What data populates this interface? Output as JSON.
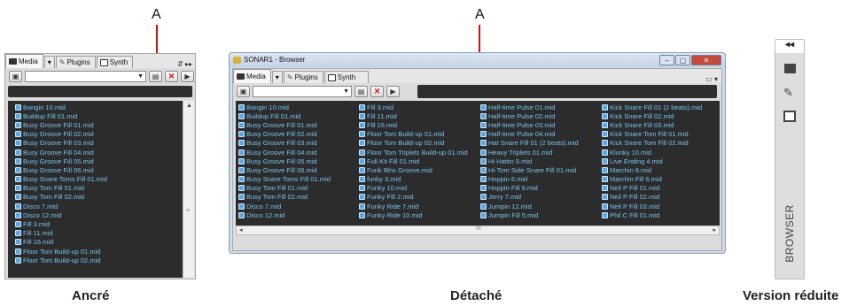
{
  "callouts": {
    "left": "A",
    "center": "A"
  },
  "captions": {
    "docked": "Ancré",
    "floating": "Détaché",
    "collapsed": "Version réduite"
  },
  "tabs": {
    "media": "Media",
    "plugins": "Plugins",
    "synth": "Synth"
  },
  "window_title": "SONAR1 - Browser",
  "collapsed_label": "BROWSER",
  "docked_files": [
    "Bangin 10.mid",
    "Buildup Fill 01.mid",
    "Busy Groove Fill 01.mid",
    "Busy Groove Fill 02.mid",
    "Busy Groove Fill 03.mid",
    "Busy Groove Fill 04.mid",
    "Busy Groove Fill 05.mid",
    "Busy Groove Fill 06.mid",
    "Busy Snare Toms Fill 01.mid",
    "Busy Tom Fill 01.mid",
    "Busy Tom Fill 02.mid",
    "Disco 7.mid",
    "Disco 12.mid",
    "Fill 3.mid",
    "Fill 11.mid",
    "Fill 16.mid",
    "Floor Tom Build-up 01.mid",
    "Floor Tom Build-up 02.mid"
  ],
  "floating_columns": [
    [
      "Bangin 10.mid",
      "Buildup Fill 01.mid",
      "Busy Groove Fill 01.mid",
      "Busy Groove Fill 02.mid",
      "Busy Groove Fill 03.mid",
      "Busy Groove Fill 04.mid",
      "Busy Groove Fill 05.mid",
      "Busy Groove Fill 06.mid",
      "Busy Snare Toms Fill 01.mid",
      "Busy Tom Fill 01.mid",
      "Busy Tom Fill 02.mid",
      "Disco 7.mid",
      "Disco 12.mid"
    ],
    [
      "Fill 3.mid",
      "Fill 11.mid",
      "Fill 16.mid",
      "Floor Tom Build-up 01.mid",
      "Floor Tom Build-up 02.mid",
      "Floor Tom Triplets Build-up 01.mid",
      "Full Kit Fill 01.mid",
      "Funk 8ths Groove.mid",
      "funky 3.mid",
      "Funky 10.mid",
      "Funky Fill 2.mid",
      "Funky Ride 7.mid",
      "Funky Ride 10.mid"
    ],
    [
      "Half-time Pulse 01.mid",
      "Half-time Pulse 02.mid",
      "Half-time Pulse 03.mid",
      "Half-time Pulse 04.mid",
      "Hat Snare Fill 01 (2 beats).mid",
      "Heavy Triplets 01.mid",
      "Hi Hattin 5.mid",
      "Hi-Tom Side Snare Fill 01.mid",
      "Hoppin 6.mid",
      "Hoppin Fill 9.mid",
      "Jerry 7.mid",
      "Jumpin 12.mid",
      "Jumpin Fill 5.mid"
    ],
    [
      "Kick Snare Fill 01 (2 beats).mid",
      "Kick Snare Fill 02.mid",
      "Kick Snare Fill 03.mid",
      "Kick Snare Tom Fill 01.mid",
      "Kick Snare Tom Fill 02.mid",
      "Klunky 10.mid",
      "Live Ending 4.mid",
      "Marchin 8.mid",
      "Marchin Fill 6.mid",
      "Neil P Fill 01.mid",
      "Neil P Fill 02.mid",
      "Neil P Fill 03.mid",
      "Phil C Fill 01.mid"
    ]
  ],
  "icons": {
    "folder": "folder-icon",
    "plugins": "plugin-icon",
    "synth": "synth-icon",
    "save": "save-icon",
    "delete": "delete-icon",
    "play": "play-icon"
  }
}
